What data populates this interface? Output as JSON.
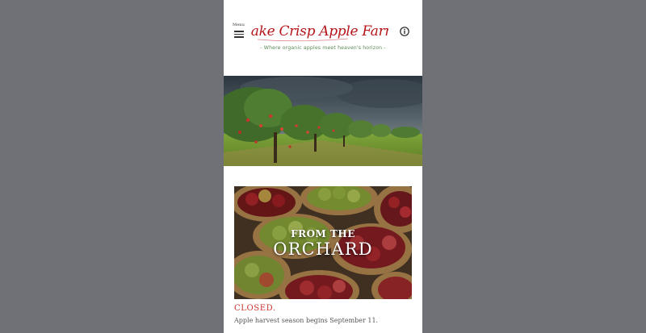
{
  "header": {
    "menu_label": "Menu",
    "logo_text": "Lake Crisp Apple Farm",
    "tagline": "- Where organic apples meet heaven's horizon -",
    "icons": {
      "menu": "hamburger-icon",
      "info": "info-icon"
    }
  },
  "feature_card": {
    "title_line1": "FROM THE",
    "title_line2": "ORCHARD"
  },
  "status": {
    "label": "CLOSED.",
    "message": "Apple harvest season begins September 11."
  },
  "colors": {
    "page_background": "#707176",
    "column_background": "#ffffff",
    "logo_red": "#b5161b",
    "tagline_green": "#5a8a55",
    "status_red": "#c7342f"
  }
}
